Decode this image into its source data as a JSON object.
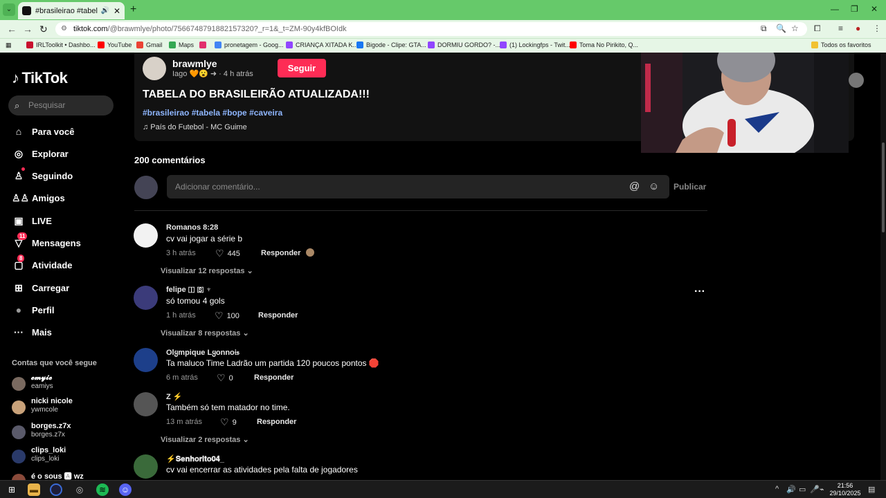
{
  "browser": {
    "tab_title": "#brasileirao #tabela #bope",
    "url_host": "tiktok.com",
    "url_path": "/@brawmlye/photo/7566748791882157320?_r=1&_t=ZM-90y4kfBOIdk",
    "bookmarks": [
      {
        "label": "IRLToolkit • Dashbo...",
        "color": "#c8102e"
      },
      {
        "label": "YouTube",
        "color": "#ff0000"
      },
      {
        "label": "Gmail",
        "color": "#ea4335"
      },
      {
        "label": "Maps",
        "color": "#34a853"
      },
      {
        "label": "",
        "color": "#e1306c"
      },
      {
        "label": "pronetagem - Goog...",
        "color": "#4285f4"
      },
      {
        "label": "CRIANÇA XITADA K...",
        "color": "#9146ff"
      },
      {
        "label": "Bigode - Clipe: GTA...",
        "color": "#1877f2"
      },
      {
        "label": "DORMIU GORDO? -...",
        "color": "#9146ff"
      },
      {
        "label": "(1) Lockingfps - Twit...",
        "color": "#9146ff"
      },
      {
        "label": "Toma No Pirikito, Q...",
        "color": "#ff0000"
      },
      {
        "label": "Todos os favoritos",
        "color": "#f1c232"
      }
    ]
  },
  "sidebar": {
    "logo": "TikTok",
    "search_placeholder": "Pesquisar",
    "nav": [
      {
        "label": "Para você",
        "icon": "home-icon",
        "glyph": "⌂"
      },
      {
        "label": "Explorar",
        "icon": "compass-icon",
        "glyph": "◎"
      },
      {
        "label": "Seguindo",
        "icon": "following-icon",
        "glyph": "👤"
      },
      {
        "label": "Amigos",
        "icon": "friends-icon",
        "glyph": "👥"
      },
      {
        "label": "LIVE",
        "icon": "live-icon",
        "glyph": "▣"
      },
      {
        "label": "Mensagens",
        "icon": "messages-icon",
        "glyph": "▽",
        "badge": "11"
      },
      {
        "label": "Atividade",
        "icon": "activity-icon",
        "glyph": "▢",
        "badge": "8"
      },
      {
        "label": "Carregar",
        "icon": "upload-icon",
        "glyph": "⊞"
      },
      {
        "label": "Perfil",
        "icon": "profile-avatar",
        "glyph": "●"
      },
      {
        "label": "Mais",
        "icon": "more-icon",
        "glyph": "···"
      }
    ],
    "following_heading": "Contas que você segue",
    "following": [
      {
        "name": "𝓮𝓶𝔂𝓲𝓮",
        "handle": "eamiys",
        "color": "#7a6a60"
      },
      {
        "name": "nicki nicole",
        "handle": "ywmcole",
        "color": "#c9a27a"
      },
      {
        "name": "borges.z7x",
        "handle": "borges.z7x",
        "color": "#5a5a6a"
      },
      {
        "name": "clips_loki",
        "handle": "clips_loki",
        "color": "#2a3a6a"
      },
      {
        "name": "é o sous 🅰 wz",
        "handle": "",
        "color": "#8a4a3a"
      }
    ]
  },
  "post": {
    "username": "brawmlye",
    "subline": "Iago 🧡😮 ➜ · 4 h atrás",
    "follow_label": "Seguir",
    "title": "TABELA DO BRASILEIRÃO ATUALIZADA!!!",
    "tags": "#brasileirao #tabela #bope #caveira",
    "music": "♫ País do Futebol - MC Guime"
  },
  "comments_section": {
    "count_label": "200 comentários",
    "input_placeholder": "Adicionar comentário...",
    "publish_label": "Publicar",
    "reply_label": "Responder",
    "comments": [
      {
        "user": "Romanos 8:28",
        "text": "cv vai jogar a série b",
        "time": "3 h atrás",
        "likes": "445",
        "replies": "Visualizar 12 respostas",
        "avatar_color": "#f2f2f2"
      },
      {
        "user": "felipe 🇮 🇸 ♆",
        "text": "só tomou 4 gols",
        "time": "1 h atrás",
        "likes": "100",
        "replies": "Visualizar 8 respostas",
        "avatar_color": "#3b3b7a"
      },
      {
        "user": "Olყmpique Lყonno𝔦𝔰",
        "text": "Ta maluco Time Ladrão um partida 120 poucos pontos 🛑",
        "time": "6 m atrás",
        "likes": "0",
        "replies": "",
        "avatar_color": "#1d3f8a"
      },
      {
        "user": "Z ⚡",
        "text": "Também só tem matador no time.",
        "time": "13 m atrás",
        "likes": "9",
        "replies": "Visualizar 2 respostas",
        "avatar_color": "#555555"
      },
      {
        "user": "⚡𝐒𝐞𝐧𝐡𝐨𝐫𝐢𝐭𝐨𝟎𝟒_",
        "text": "cv vai encerrar as atividades pela falta de jogadores",
        "time": "",
        "likes": "",
        "replies": "",
        "avatar_color": "#3a6a3a"
      }
    ]
  },
  "taskbar": {
    "time": "21:56",
    "date": "29/10/2025"
  },
  "colors": {
    "accent": "#fe2c55",
    "chrome": "#66c96a",
    "tags": "#8fb6ff"
  }
}
